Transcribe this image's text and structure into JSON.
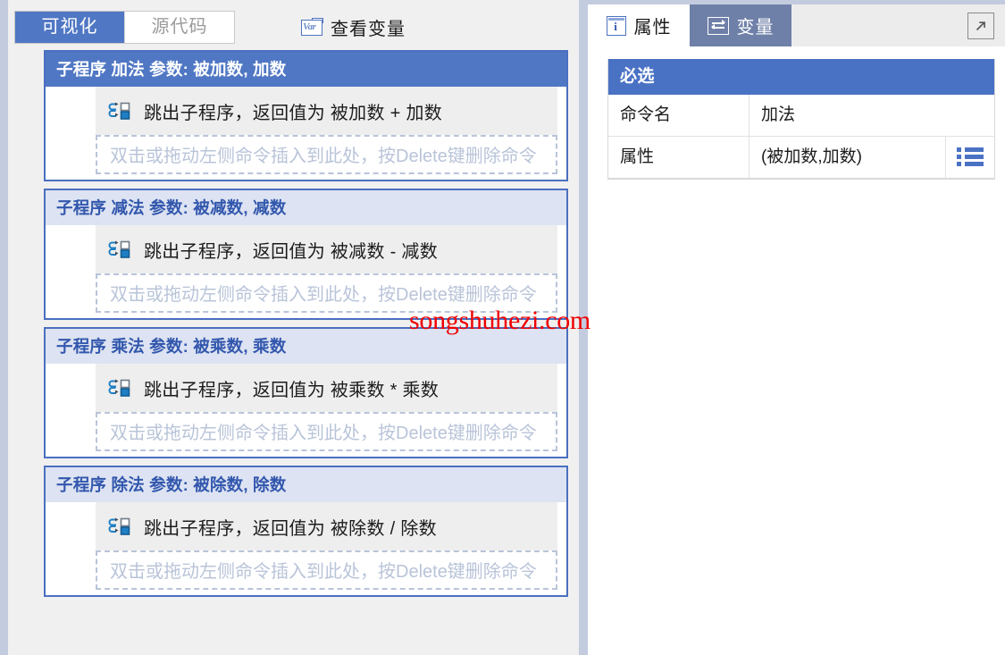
{
  "left_toolbar": {
    "tabs": [
      {
        "label": "可视化",
        "active": true
      },
      {
        "label": "源代码",
        "active": false
      }
    ],
    "view_vars": {
      "label": "查看变量",
      "icon": "var-icon",
      "icon_text": "Var"
    }
  },
  "canvas": {
    "blocks": [
      {
        "header": "子程序 加法 参数: 被加数, 加数",
        "selected": true,
        "statement": {
          "icon": "return-from-subroutine-icon",
          "text": "跳出子程序，返回值为 被加数 + 加数"
        },
        "drop_hint": "双击或拖动左侧命令插入到此处，按Delete键删除命令"
      },
      {
        "header": "子程序 减法 参数: 被减数, 减数",
        "selected": false,
        "statement": {
          "icon": "return-from-subroutine-icon",
          "text": "跳出子程序，返回值为 被减数 - 减数"
        },
        "drop_hint": "双击或拖动左侧命令插入到此处，按Delete键删除命令"
      },
      {
        "header": "子程序 乘法 参数: 被乘数, 乘数",
        "selected": false,
        "statement": {
          "icon": "return-from-subroutine-icon",
          "text": "跳出子程序，返回值为 被乘数 * 乘数"
        },
        "drop_hint": "双击或拖动左侧命令插入到此处，按Delete键删除命令"
      },
      {
        "header": "子程序 除法 参数: 被除数, 除数",
        "selected": false,
        "statement": {
          "icon": "return-from-subroutine-icon",
          "text": "跳出子程序，返回值为 被除数 / 除数"
        },
        "drop_hint": "双击或拖动左侧命令插入到此处，按Delete键删除命令"
      }
    ]
  },
  "right_panel": {
    "tabs": [
      {
        "label": "属性",
        "icon": "info-icon",
        "active": true
      },
      {
        "label": "变量",
        "icon": "swap-arrows-icon",
        "active": false
      }
    ],
    "expand_icon": "expand-arrow-icon",
    "properties": {
      "section_title": "必选",
      "rows": [
        {
          "key": "命令名",
          "value": "加法",
          "action_icon": null
        },
        {
          "key": "属性",
          "value": "(被加数,加数)",
          "action_icon": "list-icon"
        }
      ]
    }
  },
  "watermark": {
    "text": "songshuhezi.com"
  },
  "colors": {
    "accent_blue": "#4a72c4",
    "tab_active_blue": "#5077c4",
    "block_header_idle": "#dde3f2",
    "block_header_text_idle": "#3257ad",
    "rail": "#c3cbdf",
    "tab_inactive_right": "#6f80a8",
    "drop_hint": "#b9c4d9",
    "watermark_red": "#f00000",
    "canvas_bg": "#f0f0f0"
  }
}
